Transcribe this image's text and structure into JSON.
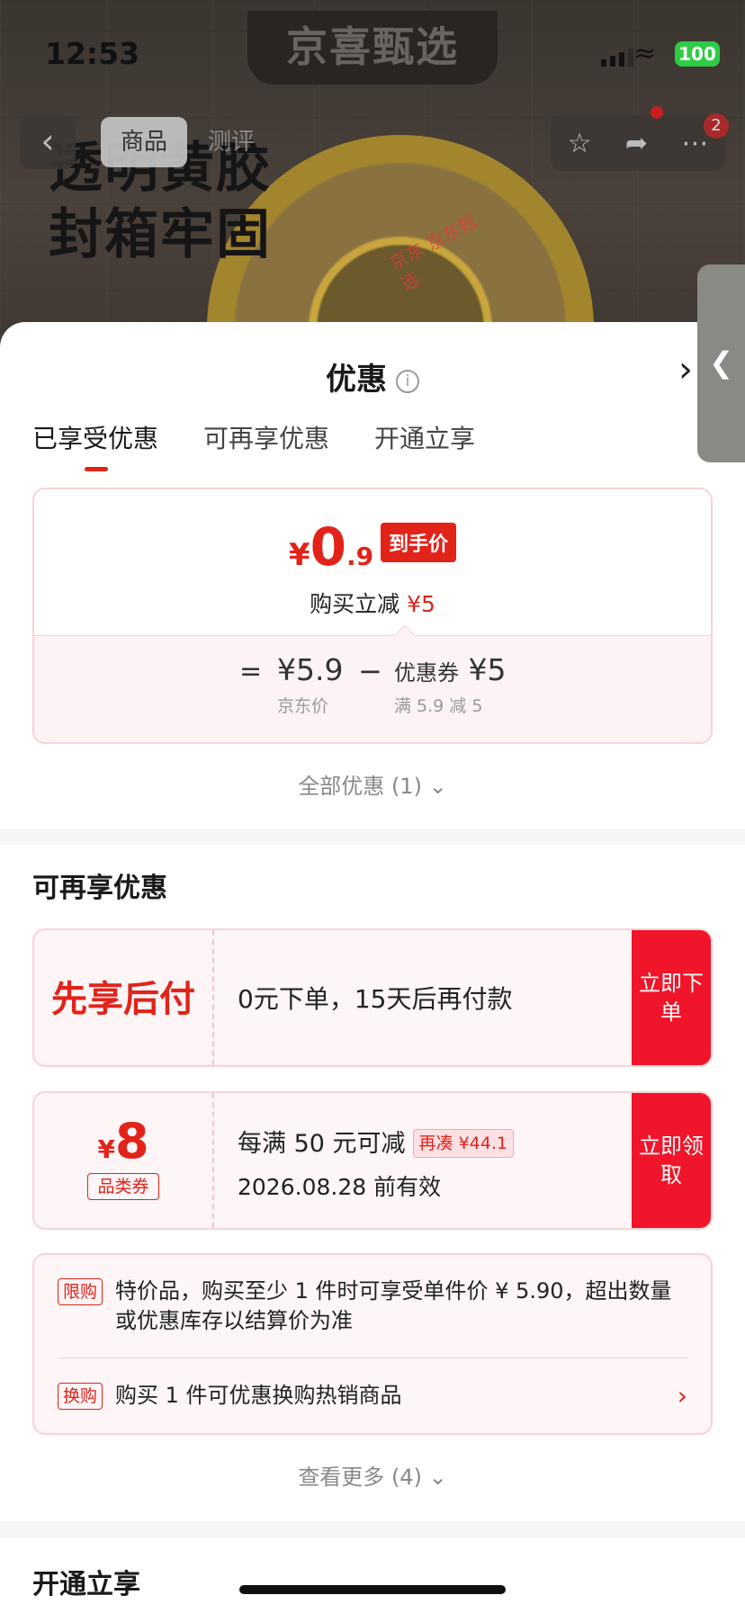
{
  "status_bar": {
    "time": "12:53",
    "battery": "100"
  },
  "background": {
    "brand": "京喜甄选",
    "nav": {
      "back_icon": "chevron-left-icon",
      "tab_goods": "商品",
      "tab_review": "测评",
      "cart_badge": "2"
    },
    "headline_line1": "透明黄胶",
    "headline_line2": "封箱牢固",
    "tape_label": "京东 京东甄选"
  },
  "sheet": {
    "title": "优惠",
    "info_icon": "i",
    "tabs": [
      {
        "label": "已享受优惠",
        "active": true
      },
      {
        "label": "可再享优惠",
        "active": false
      },
      {
        "label": "开通立享",
        "active": false
      }
    ],
    "final_price": {
      "currency": "¥",
      "integer": "0",
      "decimal": ".9",
      "tag": "到手价"
    },
    "reduce": {
      "label": "购买立减",
      "amount": "¥5"
    },
    "calc": {
      "equals": "=",
      "base_price": "¥5.9",
      "base_label": "京东价",
      "minus": "−",
      "coupon_label": "优惠券",
      "coupon_amount": "¥5",
      "coupon_rule": "满 5.9 减 5"
    },
    "all_offers": "全部优惠 (1)",
    "more_section_title": "可再享优惠",
    "bnpl": {
      "title": "先享后付",
      "desc": "0元下单，15天后再付款",
      "action": "立即下单"
    },
    "category_coupon": {
      "currency": "¥",
      "amount": "8",
      "type": "品类券",
      "rule": "每满 50 元可减",
      "chip": "再凑 ¥44.1",
      "valid": "2026.08.28 前有效",
      "action": "立即领取"
    },
    "rules": [
      {
        "tag": "限购",
        "text": "特价品，购买至少 1 件时可享受单件价 ¥ 5.90，超出数量或优惠库存以结算价为准"
      },
      {
        "tag": "换购",
        "text": "购买 1 件可优惠换购热销商品"
      }
    ],
    "see_more": "查看更多 (4)",
    "open_section_title": "开通立享"
  },
  "colors": {
    "accent": "#e2231a",
    "button_red": "#f0152a",
    "card_border": "#f6d3d6",
    "card_bg": "#fdf5f6"
  }
}
